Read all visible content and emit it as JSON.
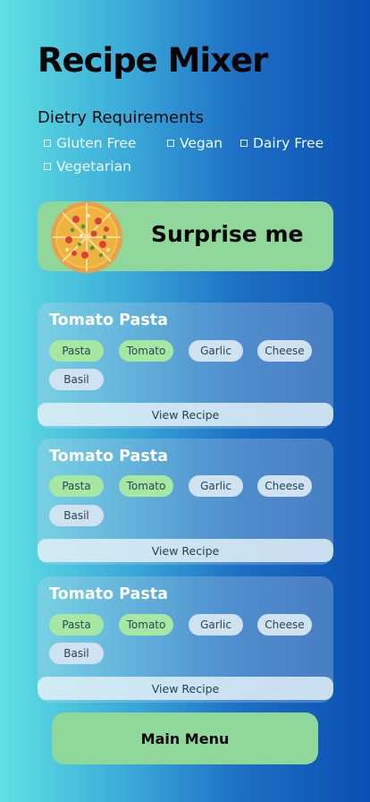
{
  "app": {
    "title": "Recipe Mixer"
  },
  "diet": {
    "heading": "Dietry Requirements",
    "options": [
      {
        "label": "Gluten Free"
      },
      {
        "label": "Vegan"
      },
      {
        "label": "Dairy Free"
      },
      {
        "label": "Vegetarian"
      }
    ]
  },
  "surprise": {
    "label": "Surprise me",
    "icon": "pizza-icon"
  },
  "recipes": [
    {
      "title": "Tomato Pasta",
      "tags": [
        "Pasta",
        "Tomato",
        "Garlic",
        "Cheese",
        "Basil"
      ],
      "action": "View Recipe"
    },
    {
      "title": "Tomato Pasta",
      "tags": [
        "Pasta",
        "Tomato",
        "Garlic",
        "Cheese",
        "Basil"
      ],
      "action": "View Recipe"
    },
    {
      "title": "Tomato Pasta",
      "tags": [
        "Pasta",
        "Tomato",
        "Garlic",
        "Cheese",
        "Basil"
      ],
      "action": "View Recipe"
    }
  ],
  "footer": {
    "main_menu_label": "Main Menu"
  },
  "colors": {
    "accent_green": "#90d79b",
    "tag_green": "#a6e8a2",
    "tag_light": "#cfe2ef",
    "bg_left": "#5fe1e3",
    "bg_right": "#0a4fb1"
  }
}
